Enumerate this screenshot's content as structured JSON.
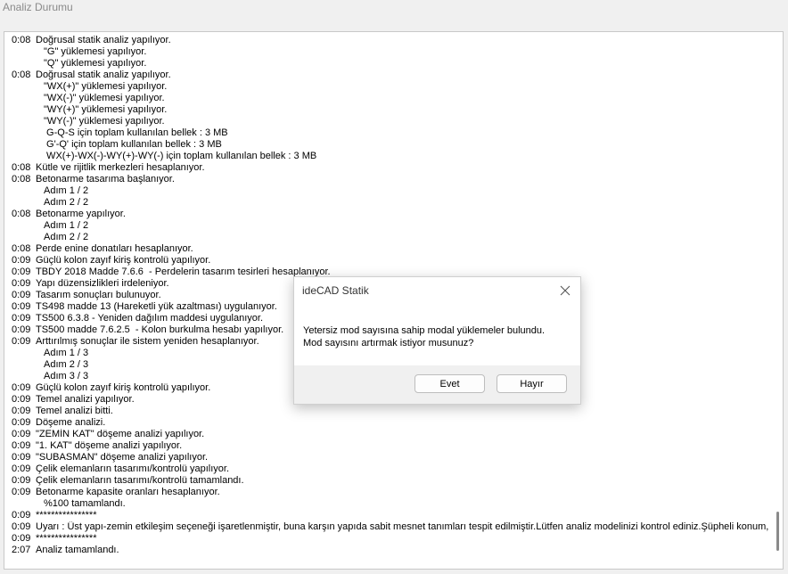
{
  "window": {
    "title": "Analiz Durumu"
  },
  "log": [
    {
      "time": "0:08",
      "indent": 0,
      "text": "Doğrusal statik analiz yapılıyor."
    },
    {
      "time": "",
      "indent": 1,
      "text": "\"G\" yüklemesi yapılıyor."
    },
    {
      "time": "",
      "indent": 1,
      "text": "\"Q\" yüklemesi yapılıyor."
    },
    {
      "time": "0:08",
      "indent": 0,
      "text": "Doğrusal statik analiz yapılıyor."
    },
    {
      "time": "",
      "indent": 1,
      "text": "\"WX(+)\" yüklemesi yapılıyor."
    },
    {
      "time": "",
      "indent": 1,
      "text": "\"WX(-)\" yüklemesi yapılıyor."
    },
    {
      "time": "",
      "indent": 1,
      "text": "\"WY(+)\" yüklemesi yapılıyor."
    },
    {
      "time": "",
      "indent": 1,
      "text": "\"WY(-)\" yüklemesi yapılıyor."
    },
    {
      "time": "",
      "indent": 1,
      "text": " G-Q-S için toplam kullanılan bellek : 3 MB"
    },
    {
      "time": "",
      "indent": 1,
      "text": " G'-Q' için toplam kullanılan bellek : 3 MB"
    },
    {
      "time": "",
      "indent": 1,
      "text": " WX(+)-WX(-)-WY(+)-WY(-) için toplam kullanılan bellek : 3 MB"
    },
    {
      "time": "0:08",
      "indent": 0,
      "text": "Kütle ve rijitlik merkezleri hesaplanıyor."
    },
    {
      "time": "0:08",
      "indent": 0,
      "text": "Betonarme tasarıma başlanıyor."
    },
    {
      "time": "",
      "indent": 1,
      "text": "Adım 1 / 2"
    },
    {
      "time": "",
      "indent": 1,
      "text": "Adım 2 / 2"
    },
    {
      "time": "0:08",
      "indent": 0,
      "text": "Betonarme yapılıyor."
    },
    {
      "time": "",
      "indent": 1,
      "text": "Adım 1 / 2"
    },
    {
      "time": "",
      "indent": 1,
      "text": "Adım 2 / 2"
    },
    {
      "time": "0:08",
      "indent": 0,
      "text": "Perde enine donatıları hesaplanıyor."
    },
    {
      "time": "0:09",
      "indent": 0,
      "text": "Güçlü kolon zayıf kiriş kontrolü yapılıyor."
    },
    {
      "time": "0:09",
      "indent": 0,
      "text": "TBDY 2018 Madde 7.6.6  - Perdelerin tasarım tesirleri hesaplanıyor."
    },
    {
      "time": "0:09",
      "indent": 0,
      "text": "Yapı düzensizlikleri irdeleniyor."
    },
    {
      "time": "0:09",
      "indent": 0,
      "text": "Tasarım sonuçları bulunuyor."
    },
    {
      "time": "0:09",
      "indent": 0,
      "text": "TS498 madde 13 (Hareketli yük azaltması) uygulanıyor."
    },
    {
      "time": "0:09",
      "indent": 0,
      "text": "TS500 6.3.8 - Yeniden dağılım maddesi uygulanıyor."
    },
    {
      "time": "0:09",
      "indent": 0,
      "text": "TS500 madde 7.6.2.5  - Kolon burkulma hesabı yapılıyor."
    },
    {
      "time": "0:09",
      "indent": 0,
      "text": "Arttırılmış sonuçlar ile sistem yeniden hesaplanıyor."
    },
    {
      "time": "",
      "indent": 1,
      "text": "Adım 1 / 3"
    },
    {
      "time": "",
      "indent": 1,
      "text": "Adım 2 / 3"
    },
    {
      "time": "",
      "indent": 1,
      "text": "Adım 3 / 3"
    },
    {
      "time": "0:09",
      "indent": 0,
      "text": "Güçlü kolon zayıf kiriş kontrolü yapılıyor."
    },
    {
      "time": "0:09",
      "indent": 0,
      "text": "Temel analizi yapılıyor."
    },
    {
      "time": "0:09",
      "indent": 0,
      "text": "Temel analizi bitti."
    },
    {
      "time": "0:09",
      "indent": 0,
      "text": "Döşeme analizi."
    },
    {
      "time": "0:09",
      "indent": 0,
      "text": "\"ZEMİN KAT\" döşeme analizi yapılıyor."
    },
    {
      "time": "0:09",
      "indent": 0,
      "text": "\"1. KAT\" döşeme analizi yapılıyor."
    },
    {
      "time": "0:09",
      "indent": 0,
      "text": "\"SUBASMAN\" döşeme analizi yapılıyor."
    },
    {
      "time": "0:09",
      "indent": 0,
      "text": "Çelik elemanların tasarımı/kontrolü yapılıyor."
    },
    {
      "time": "0:09",
      "indent": 0,
      "text": "Çelik elemanların tasarımı/kontrolü tamamlandı."
    },
    {
      "time": "0:09",
      "indent": 0,
      "text": "Betonarme kapasite oranları hesaplanıyor."
    },
    {
      "time": "",
      "indent": 1,
      "text": "%100 tamamlandı."
    },
    {
      "time": "0:09",
      "indent": 0,
      "text": "****************"
    },
    {
      "time": "0:09",
      "indent": 0,
      "text": "Uyarı : Üst yapı-zemin etkileşim seçeneği işaretlenmiştir, buna karşın yapıda sabit mesnet tanımları tespit edilmiştir.Lütfen analiz modelinizi kontrol ediniz.Şüpheli konum, hare"
    },
    {
      "time": "0:09",
      "indent": 0,
      "text": "****************"
    },
    {
      "time": "2:07",
      "indent": 0,
      "text": "Analiz tamamlandı."
    }
  ],
  "dialog": {
    "title": "ideCAD Statik",
    "message_line1": "Yetersiz mod sayısına sahip modal yüklemeler bulundu.",
    "message_line2": "Mod sayısını artırmak istiyor musunuz?",
    "yes_label": "Evet",
    "no_label": "Hayır",
    "close_icon": "close-icon"
  }
}
